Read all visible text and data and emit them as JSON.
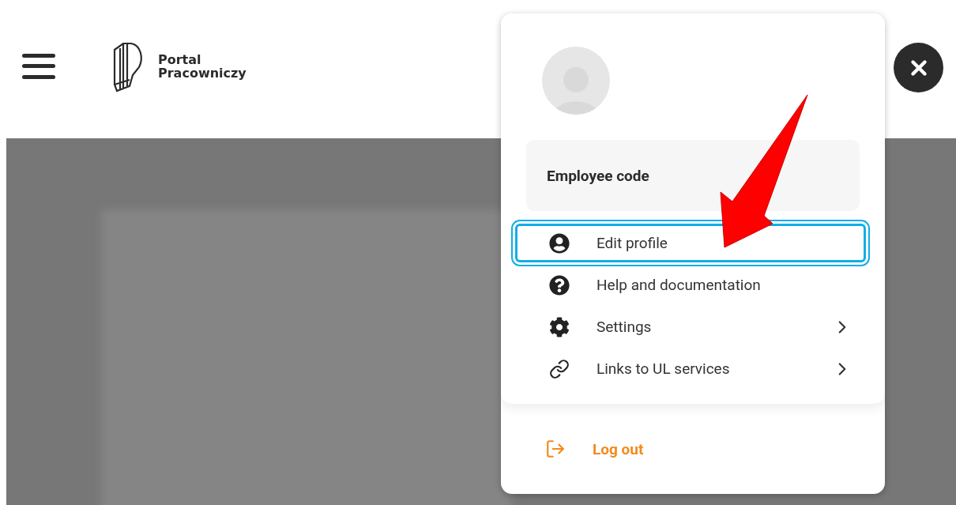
{
  "header": {
    "logo_text": [
      "Portal",
      "Pracowniczy"
    ]
  },
  "profile_menu": {
    "code_label": "Employee code",
    "items": [
      {
        "kind": "account",
        "label": "Edit profile",
        "selected": true,
        "submenu": false
      },
      {
        "kind": "help",
        "label": "Help and documentation",
        "selected": false,
        "submenu": false
      },
      {
        "kind": "settings",
        "label": "Settings",
        "selected": false,
        "submenu": true
      },
      {
        "kind": "link",
        "label": "Links to UL services",
        "selected": false,
        "submenu": true
      }
    ],
    "logout": {
      "label": "Log out"
    }
  }
}
